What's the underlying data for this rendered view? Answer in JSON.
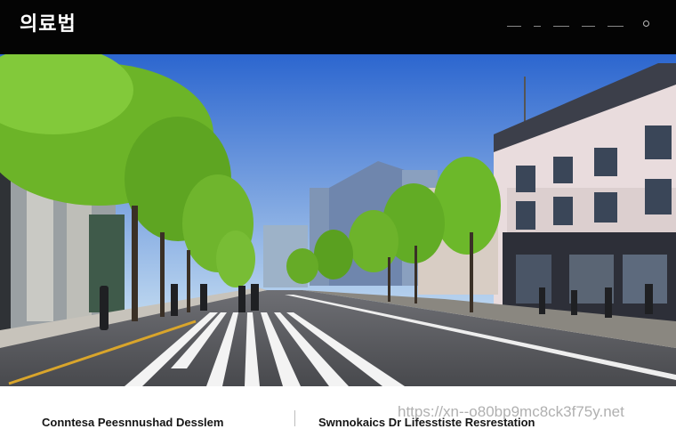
{
  "header": {
    "logo_text": "의료법",
    "logo_subtext": "",
    "nav_items": [
      "",
      "",
      "",
      "",
      ""
    ],
    "search_icon": "search-icon"
  },
  "hero": {
    "image_description": "",
    "colors": {
      "sky_top": "#2f6fd6",
      "sky_bottom": "#b9d3ef",
      "road": "#5a5b60",
      "tree": "#6fb52a",
      "building": "#e8d9da"
    }
  },
  "footer": {
    "caption_left": "Conntesa Peesnnushad Desslem",
    "caption_right": "Swnnokaics Dr Lifesstiste Resrestation",
    "watermark": "https://xn--o80bp9mc8ck3f75y.net"
  }
}
